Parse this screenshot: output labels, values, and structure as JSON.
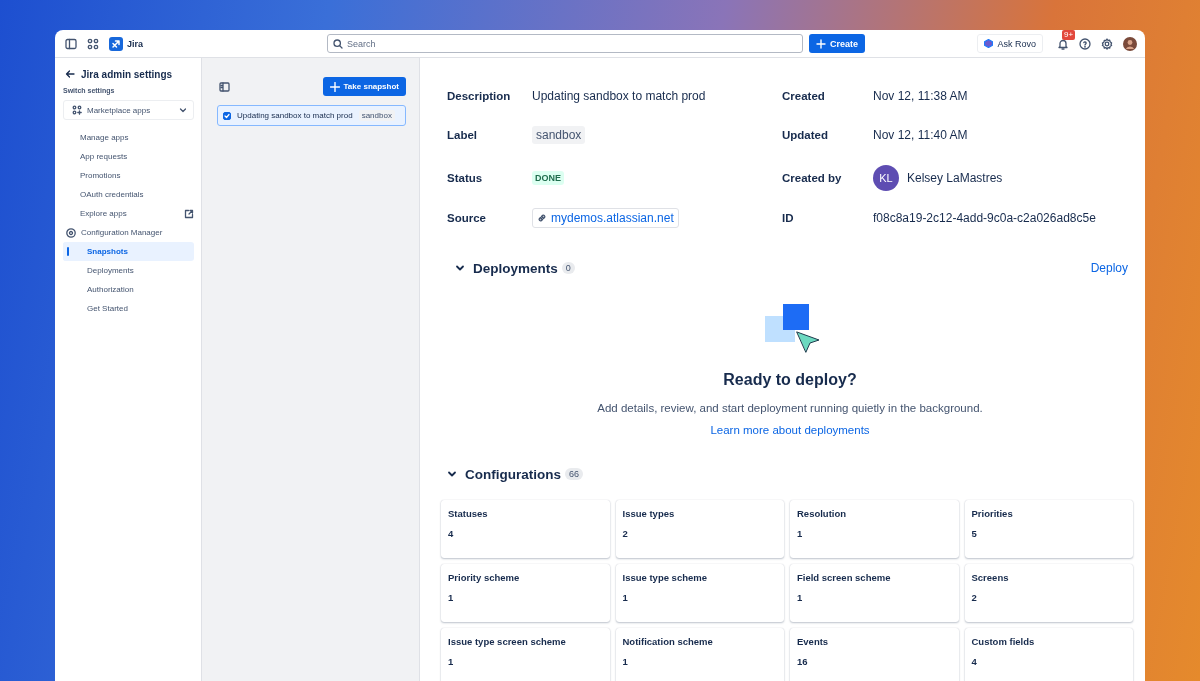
{
  "topbar": {
    "app_name": "Jira",
    "search": {
      "placeholder": "Search"
    },
    "create_button": "Create",
    "ask_button": "Ask Rovo",
    "notification_badge": "9+"
  },
  "sidebar": {
    "title": "Jira admin settings",
    "switch_label": "Switch settings",
    "switcher": "Marketplace apps",
    "items": [
      {
        "label": "Manage apps",
        "external": false,
        "selected": false
      },
      {
        "label": "App requests",
        "external": false,
        "selected": false
      },
      {
        "label": "Promotions",
        "external": false,
        "selected": false
      },
      {
        "label": "OAuth credentials",
        "external": false,
        "selected": false
      },
      {
        "label": "Explore apps",
        "external": true,
        "selected": false
      },
      {
        "label": "Configuration Manager",
        "external": false,
        "selected": false,
        "expanded": true,
        "children": [
          {
            "label": "Snapshots",
            "selected": true
          },
          {
            "label": "Deployments",
            "selected": false
          },
          {
            "label": "Authorization",
            "selected": false
          },
          {
            "label": "Get Started",
            "selected": false
          }
        ]
      }
    ]
  },
  "snapshots": {
    "button": "Take snapshot",
    "items": [
      {
        "description": "Updating sandbox to match prod",
        "label": "sandbox",
        "checked": true,
        "selected": true
      }
    ]
  },
  "details": {
    "fields": [
      {
        "label": "Description",
        "value": "Updating sandbox to match prod",
        "kind": "text"
      },
      {
        "label": "Created",
        "value": "Nov 12, 11:38 AM",
        "kind": "text"
      },
      {
        "label": "Label",
        "value": "sandbox",
        "kind": "tag"
      },
      {
        "label": "Updated",
        "value": "Nov 12, 11:40 AM",
        "kind": "text"
      },
      {
        "label": "Status",
        "value": "DONE",
        "kind": "status"
      },
      {
        "label": "Created by",
        "value": "Kelsey LaMastres",
        "initials": "KL",
        "kind": "user"
      },
      {
        "label": "Source",
        "value": "mydemos.atlassian.net",
        "kind": "link"
      },
      {
        "label": "ID",
        "value": "f08c8a19-2c12-4add-9c0a-c2a026ad8c5e",
        "kind": "text"
      }
    ]
  },
  "deployments": {
    "title": "Deployments",
    "count": "0",
    "expanded": true,
    "action": "Deploy",
    "empty_title": "Ready to deploy?",
    "empty_text": "Add details, review, and start deployment running quietly in the background.",
    "empty_link": "Learn more about deployments"
  },
  "configurations": {
    "title": "Configurations",
    "count": "66",
    "expanded": true,
    "items": [
      {
        "name": "Statuses",
        "count": "4"
      },
      {
        "name": "Issue types",
        "count": "2"
      },
      {
        "name": "Resolution",
        "count": "1"
      },
      {
        "name": "Priorities",
        "count": "5"
      },
      {
        "name": "Priority scheme",
        "count": "1"
      },
      {
        "name": "Issue type scheme",
        "count": "1"
      },
      {
        "name": "Field screen scheme",
        "count": "1"
      },
      {
        "name": "Screens",
        "count": "2"
      },
      {
        "name": "Issue type screen scheme",
        "count": "1"
      },
      {
        "name": "Notification scheme",
        "count": "1"
      },
      {
        "name": "Events",
        "count": "16"
      },
      {
        "name": "Custom fields",
        "count": "4"
      }
    ]
  }
}
